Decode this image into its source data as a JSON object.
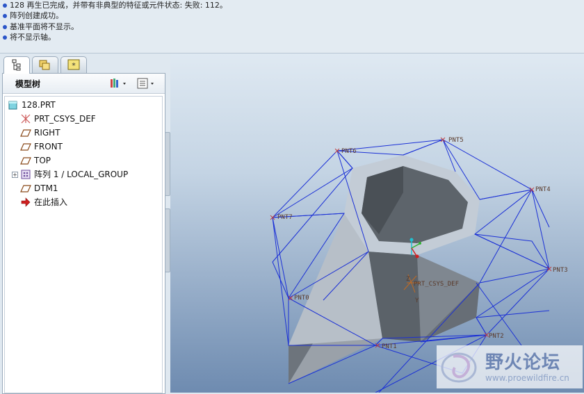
{
  "messages": [
    "128 再生已完成，并带有非典型的特征或元件状态: 失败: 112。",
    "阵列创建成功。",
    "基准平面将不显示。",
    "将不显示轴。"
  ],
  "tabs": [
    {
      "icon": "model-tree-icon",
      "active": true
    },
    {
      "icon": "folder-browser-icon",
      "active": false
    },
    {
      "icon": "favorites-icon",
      "active": false
    }
  ],
  "panel": {
    "title": "模型树",
    "settings_icon": "tree-settings-icon",
    "columns_icon": "tree-columns-icon"
  },
  "tree": [
    {
      "label": "128.PRT",
      "icon": "part-icon"
    },
    {
      "label": "PRT_CSYS_DEF",
      "icon": "csys-icon"
    },
    {
      "label": "RIGHT",
      "icon": "datum-plane-icon"
    },
    {
      "label": "FRONT",
      "icon": "datum-plane-icon"
    },
    {
      "label": "TOP",
      "icon": "datum-plane-icon"
    },
    {
      "label": "阵列 1 / LOCAL_GROUP",
      "icon": "pattern-icon"
    },
    {
      "label": "DTM1",
      "icon": "datum-plane-icon"
    },
    {
      "label": "在此插入",
      "icon": "insert-here-arrow-icon"
    }
  ],
  "viewport": {
    "point_labels": [
      "PNT5",
      "PNT6",
      "PNT4",
      "PNT7",
      "PNT3",
      "PNT0",
      "PNT1",
      "PNT2"
    ],
    "csys_label": "PRT_CSYS_DEF",
    "axis_labels": [
      "Z",
      "Y"
    ]
  },
  "watermark": {
    "title": "野火论坛",
    "url": "www.proewildfire.cn"
  },
  "colors": {
    "wire": "#1a2fd6",
    "solid_top": "#b9c3ce",
    "solid_side": "#8a929c",
    "solid_dark": "#5f666e"
  }
}
